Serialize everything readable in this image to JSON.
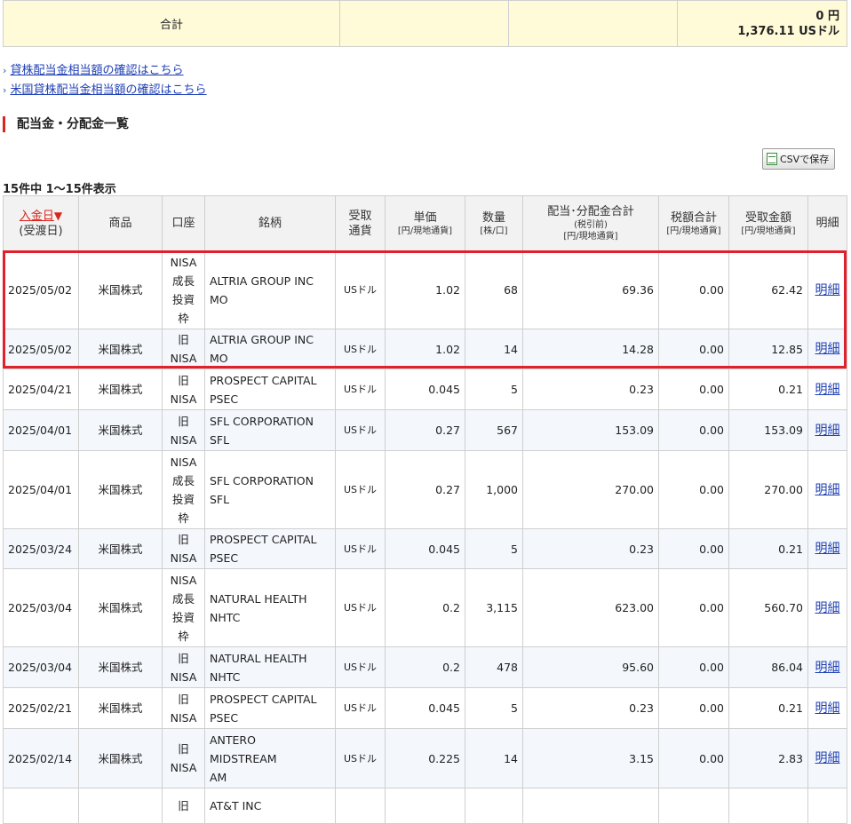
{
  "summary": {
    "label": "合計",
    "amount_jpy": "0 円",
    "amount_usd": "1,376.11 USドル"
  },
  "links": [
    {
      "arrow": "›",
      "text": "貸株配当金相当額の確認はこちら"
    },
    {
      "arrow": "›",
      "text": "米国貸株配当金相当額の確認はこちら"
    }
  ],
  "section_title": "配当金・分配金一覧",
  "csv_button": "CSVで保存",
  "count_text": "15件中 1～15件表示",
  "columns": {
    "date": {
      "label": "入金日",
      "arrow": "▼",
      "sub": "(受渡日)"
    },
    "product": "商品",
    "account": "口座",
    "name": "銘柄",
    "currency": {
      "line1": "受取",
      "line2": "通貨"
    },
    "unit_price": {
      "label": "単価",
      "sub": "[円/現地通貨]"
    },
    "quantity": {
      "label": "数量",
      "sub": "[株/口]"
    },
    "total": {
      "label": "配当･分配金合計",
      "sub1": "(税引前)",
      "sub2": "[円/現地通貨]"
    },
    "tax": {
      "label": "税額合計",
      "sub": "[円/現地通貨]"
    },
    "received": {
      "label": "受取金額",
      "sub": "[円/現地通貨]"
    },
    "detail": "明細"
  },
  "rows": [
    {
      "date": "2025/05/02",
      "product": "米国株式",
      "account": "NISA\n成長\n投資\n枠",
      "name": "ALTRIA GROUP INC\nMO",
      "currency": "USドル",
      "unit_price": "1.02",
      "quantity": "68",
      "total": "69.36",
      "tax": "0.00",
      "received": "62.42",
      "detail": "明細"
    },
    {
      "date": "2025/05/02",
      "product": "米国株式",
      "account": "旧\nNISA",
      "name": "ALTRIA GROUP INC\nMO",
      "currency": "USドル",
      "unit_price": "1.02",
      "quantity": "14",
      "total": "14.28",
      "tax": "0.00",
      "received": "12.85",
      "detail": "明細"
    },
    {
      "date": "2025/04/21",
      "product": "米国株式",
      "account": "旧\nNISA",
      "name": "PROSPECT CAPITAL\nPSEC",
      "currency": "USドル",
      "unit_price": "0.045",
      "quantity": "5",
      "total": "0.23",
      "tax": "0.00",
      "received": "0.21",
      "detail": "明細"
    },
    {
      "date": "2025/04/01",
      "product": "米国株式",
      "account": "旧\nNISA",
      "name": "SFL CORPORATION\nSFL",
      "currency": "USドル",
      "unit_price": "0.27",
      "quantity": "567",
      "total": "153.09",
      "tax": "0.00",
      "received": "153.09",
      "detail": "明細"
    },
    {
      "date": "2025/04/01",
      "product": "米国株式",
      "account": "NISA\n成長\n投資\n枠",
      "name": "SFL CORPORATION\nSFL",
      "currency": "USドル",
      "unit_price": "0.27",
      "quantity": "1,000",
      "total": "270.00",
      "tax": "0.00",
      "received": "270.00",
      "detail": "明細"
    },
    {
      "date": "2025/03/24",
      "product": "米国株式",
      "account": "旧\nNISA",
      "name": "PROSPECT CAPITAL\nPSEC",
      "currency": "USドル",
      "unit_price": "0.045",
      "quantity": "5",
      "total": "0.23",
      "tax": "0.00",
      "received": "0.21",
      "detail": "明細"
    },
    {
      "date": "2025/03/04",
      "product": "米国株式",
      "account": "NISA\n成長\n投資\n枠",
      "name": "NATURAL HEALTH\nNHTC",
      "currency": "USドル",
      "unit_price": "0.2",
      "quantity": "3,115",
      "total": "623.00",
      "tax": "0.00",
      "received": "560.70",
      "detail": "明細"
    },
    {
      "date": "2025/03/04",
      "product": "米国株式",
      "account": "旧\nNISA",
      "name": "NATURAL HEALTH\nNHTC",
      "currency": "USドル",
      "unit_price": "0.2",
      "quantity": "478",
      "total": "95.60",
      "tax": "0.00",
      "received": "86.04",
      "detail": "明細"
    },
    {
      "date": "2025/02/21",
      "product": "米国株式",
      "account": "旧\nNISA",
      "name": "PROSPECT CAPITAL\nPSEC",
      "currency": "USドル",
      "unit_price": "0.045",
      "quantity": "5",
      "total": "0.23",
      "tax": "0.00",
      "received": "0.21",
      "detail": "明細"
    },
    {
      "date": "2025/02/14",
      "product": "米国株式",
      "account": "旧\nNISA",
      "name": "ANTERO\nMIDSTREAM\nAM",
      "currency": "USドル",
      "unit_price": "0.225",
      "quantity": "14",
      "total": "3.15",
      "tax": "0.00",
      "received": "2.83",
      "detail": "明細"
    },
    {
      "date": "",
      "product": "",
      "account": "旧",
      "name": "AT&T INC",
      "currency": "",
      "unit_price": "",
      "quantity": "",
      "total": "",
      "tax": "",
      "received": "",
      "detail": ""
    }
  ]
}
